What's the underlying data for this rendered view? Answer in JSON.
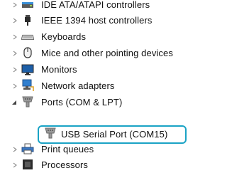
{
  "device_manager_tree": {
    "items": [
      {
        "label": "IDE ATA/ATAPI controllers",
        "icon": "ide-controller-icon",
        "expanded": false
      },
      {
        "label": "IEEE 1394 host controllers",
        "icon": "ieee1394-plug-icon",
        "expanded": false
      },
      {
        "label": "Keyboards",
        "icon": "keyboard-icon",
        "expanded": false
      },
      {
        "label": "Mice and other pointing devices",
        "icon": "mouse-icon",
        "expanded": false
      },
      {
        "label": "Monitors",
        "icon": "monitor-icon",
        "expanded": false
      },
      {
        "label": "Network adapters",
        "icon": "network-adapter-icon",
        "expanded": false
      },
      {
        "label": "Ports (COM & LPT)",
        "icon": "port-connector-icon",
        "expanded": true,
        "children": [
          {
            "label": "USB Serial Port (COM15)",
            "icon": "port-connector-icon",
            "highlighted": true
          }
        ]
      },
      {
        "label": "Print queues",
        "icon": "printer-icon",
        "expanded": false
      },
      {
        "label": "Processors",
        "icon": "processor-icon",
        "expanded": false
      }
    ]
  },
  "colors": {
    "highlight_border": "#1aa3c5",
    "chevron": "#7a7a7a",
    "text": "#111111"
  }
}
